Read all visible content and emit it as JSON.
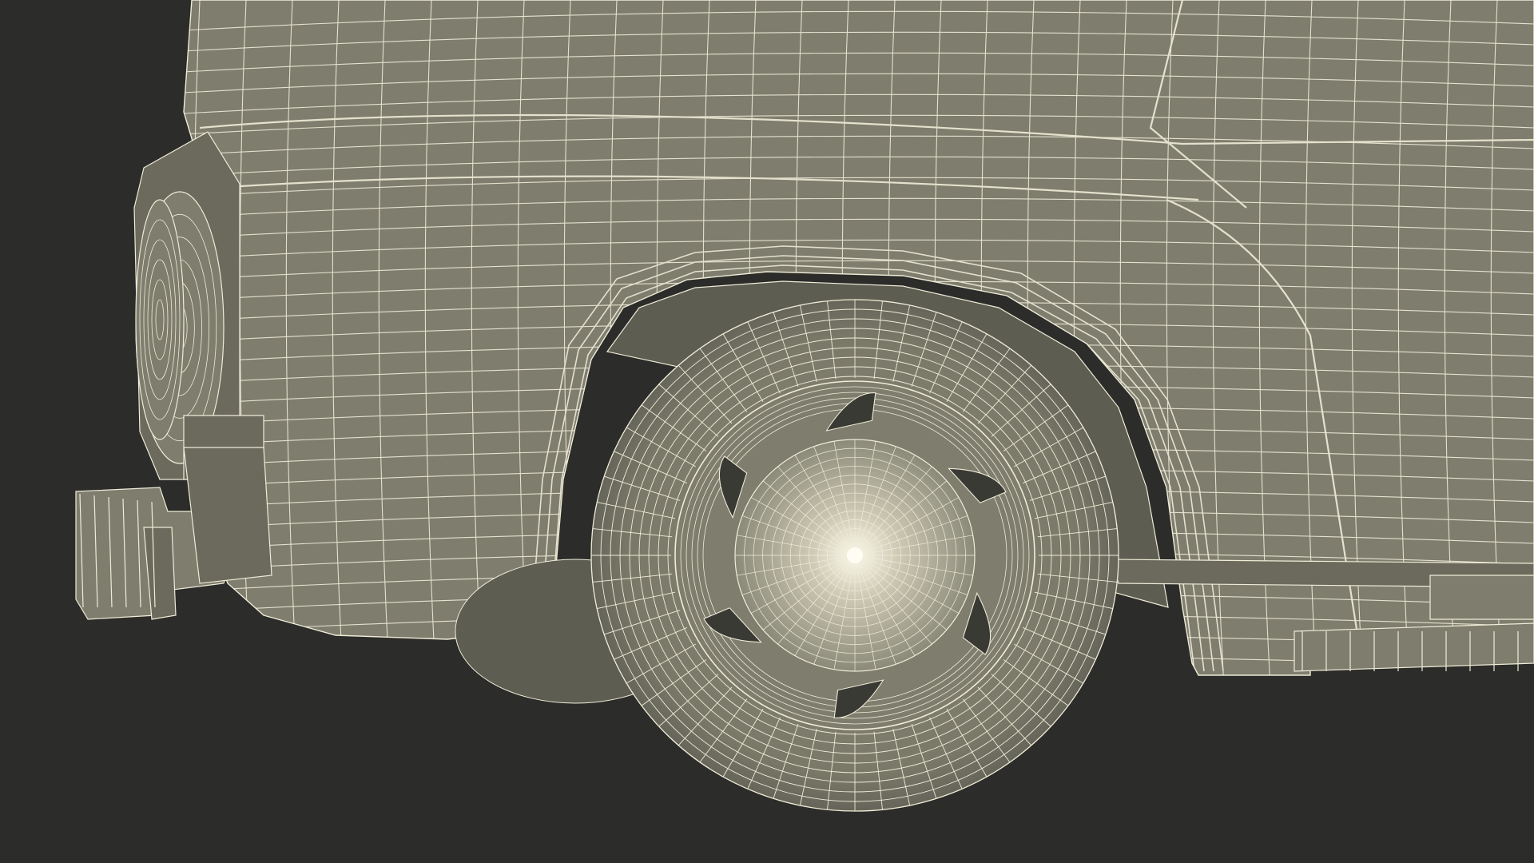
{
  "colors": {
    "background": "#2c2c2a",
    "body": "#7e7d6e",
    "body_dark": "#6b6a5d",
    "shadow": "#5e5d52",
    "wire": "#f0ecd8"
  },
  "scene": {
    "subject": "wireframe-car-front-wheel",
    "wheel": {
      "spokes": 6
    }
  }
}
